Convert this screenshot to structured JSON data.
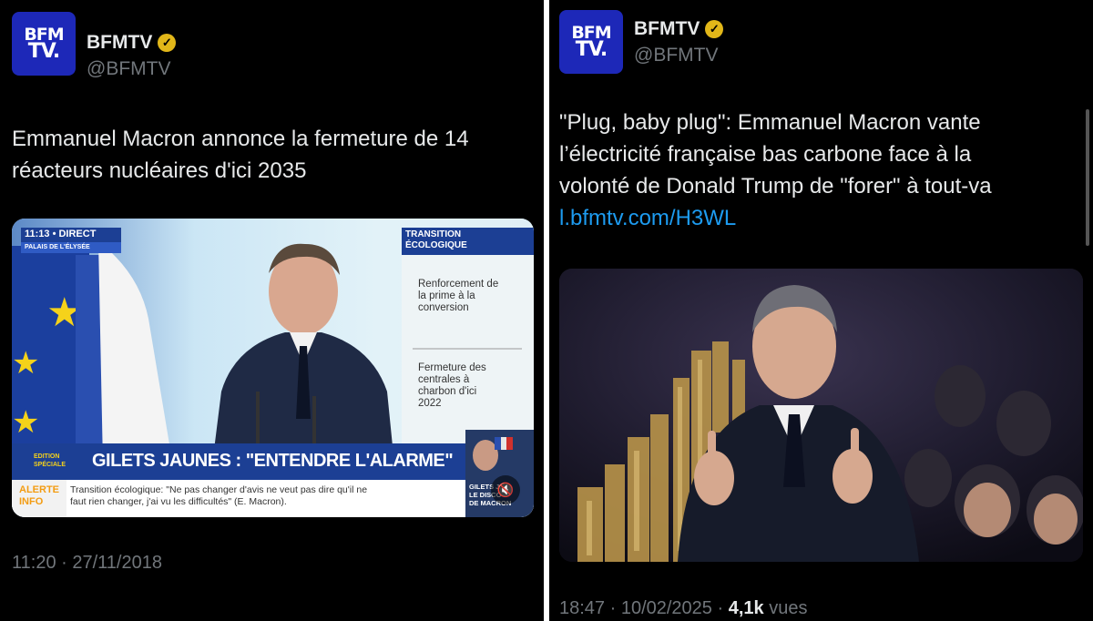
{
  "tweets": [
    {
      "avatar": {
        "line1": "BFM",
        "line2": "TV."
      },
      "name": "BFMTV",
      "verified_icon": "verified-badge-icon",
      "handle": "@BFMTV",
      "text_lines": [
        "Emmanuel Macron annonce la fermeture de 14",
        "réacteurs nucléaires d'ici 2035"
      ],
      "media": {
        "overlay": {
          "time_live": "11:13 • DIRECT",
          "location": "PALAIS DE L'ÉLYSÉE",
          "topic_line1": "TRANSITION",
          "topic_line2": "ÉCOLOGIQUE",
          "bullet1": [
            "Renforcement de",
            "la prime à la",
            "conversion"
          ],
          "bullet2": [
            "Fermeture des",
            "centrales à",
            "charbon d'ici",
            "2022"
          ],
          "edition_label": [
            "EDITION",
            "SPÉCIALE"
          ],
          "headline": "GILETS JAUNES : \"ENTENDRE L'ALARME\"",
          "alerte_label": [
            "ALERTE",
            "INFO"
          ],
          "ticker_line1": "Transition écologique: \"Ne pas changer d'avis ne veut pas dire qu'il ne",
          "ticker_line2": "faut rien changer, j'ai vu les difficultés\" (E. Macron).",
          "thumb_caption": [
            "GILETS J",
            "LE DISCO",
            "DE MACRON"
          ]
        },
        "mute_icon": "speaker-mute-icon"
      },
      "timestamp": "11:20 · 27/11/2018"
    },
    {
      "avatar": {
        "line1": "BFM",
        "line2": "TV."
      },
      "name": "BFMTV",
      "verified_icon": "verified-badge-icon",
      "handle": "@BFMTV",
      "text_lines": [
        "\"Plug, baby plug\": Emmanuel Macron vante",
        "l’électricité française bas carbone face à la",
        "volonté de Donald Trump de \"forer\" à tout-va"
      ],
      "link": "l.bfmtv.com/H3WL",
      "timestamp": "18:47 · 10/02/2025 · ",
      "views_count": "4,1k",
      "views_label": " vues"
    }
  ],
  "colors": {
    "background": "#000000",
    "text": "#e7e9ea",
    "muted": "#71767b",
    "link": "#1d9bf0",
    "avatar": "#1d28b8",
    "badge": "#e2b719"
  }
}
